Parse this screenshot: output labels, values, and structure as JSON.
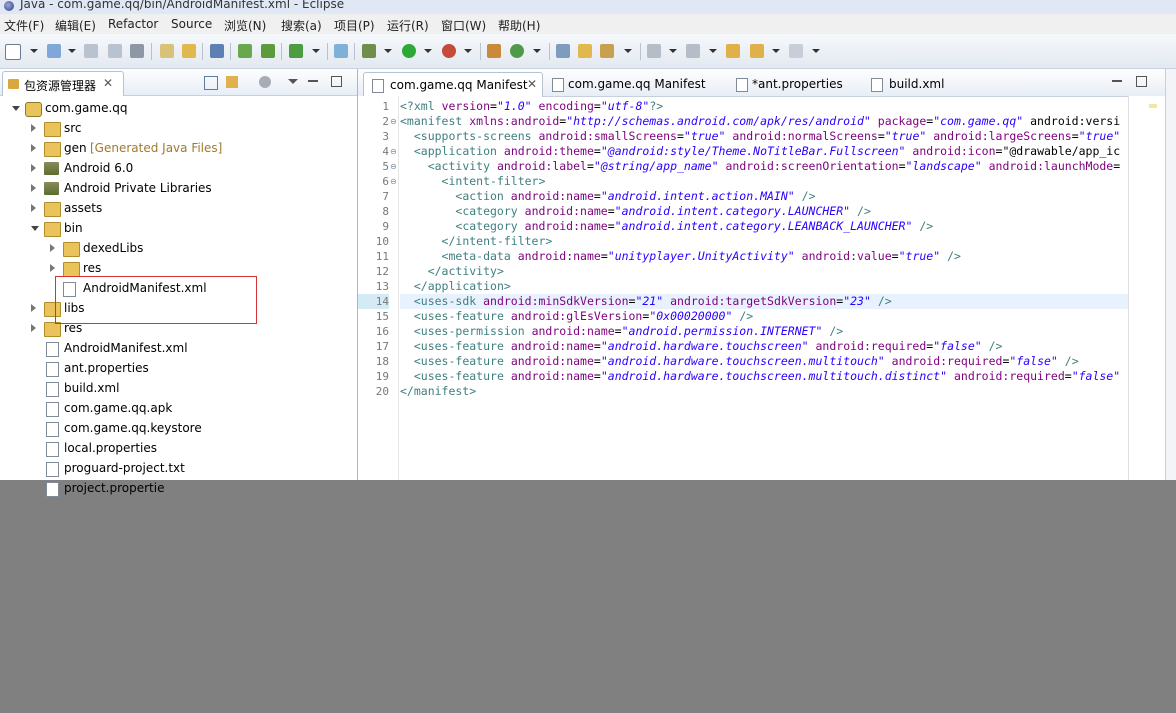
{
  "window": {
    "title": "Java - com.game.qq/bin/AndroidManifest.xml - Eclipse"
  },
  "menu": [
    "文件(F)",
    "编辑(E)",
    "Refactor",
    "Source",
    "浏览(N)",
    "搜索(a)",
    "项目(P)",
    "运行(R)",
    "窗口(W)",
    "帮助(H)"
  ],
  "explorer": {
    "title": "包资源管理器",
    "close": "✕",
    "tree": [
      {
        "label": "com.game.qq",
        "icon": "project-icon",
        "twisty": "expanded"
      },
      {
        "label": "src",
        "icon": "package-folder-icon",
        "twisty": "collapsed"
      },
      {
        "label": "gen",
        "decoration": "[Generated Java Files]",
        "icon": "package-folder-icon",
        "twisty": "collapsed"
      },
      {
        "label": "Android 6.0",
        "icon": "library-icon",
        "twisty": "collapsed"
      },
      {
        "label": "Android Private Libraries",
        "icon": "library-icon",
        "twisty": "collapsed"
      },
      {
        "label": "assets",
        "icon": "folder-icon",
        "twisty": "collapsed"
      },
      {
        "label": "bin",
        "icon": "folder-icon",
        "twisty": "expanded"
      },
      {
        "label": "dexedLibs",
        "icon": "folder-icon",
        "twisty": "collapsed"
      },
      {
        "label": "res",
        "icon": "folder-icon",
        "twisty": "collapsed"
      },
      {
        "label": "AndroidManifest.xml",
        "icon": "xml-file-icon",
        "twisty": "none"
      },
      {
        "label": "libs",
        "icon": "folder-icon",
        "twisty": "collapsed"
      },
      {
        "label": "res",
        "icon": "folder-icon",
        "twisty": "collapsed"
      },
      {
        "label": "AndroidManifest.xml",
        "icon": "xml-file-icon",
        "twisty": "none"
      },
      {
        "label": "ant.properties",
        "icon": "file-icon",
        "twisty": "none"
      },
      {
        "label": "build.xml",
        "icon": "xml-file-icon",
        "twisty": "none"
      },
      {
        "label": "com.game.qq.apk",
        "icon": "file-icon",
        "twisty": "none"
      },
      {
        "label": "com.game.qq.keystore",
        "icon": "file-icon",
        "twisty": "none"
      },
      {
        "label": "local.properties",
        "icon": "file-icon",
        "twisty": "none"
      },
      {
        "label": "proguard-project.txt",
        "icon": "file-icon",
        "twisty": "none"
      },
      {
        "label": "project.propertie",
        "icon": "file-icon",
        "twisty": "none"
      }
    ]
  },
  "editor": {
    "tabs": [
      {
        "label": "com.game.qq Manifest",
        "close": "✕",
        "active": true
      },
      {
        "label": "com.game.qq Manifest",
        "active": false
      },
      {
        "label": "*ant.properties",
        "active": false
      },
      {
        "label": "build.xml",
        "active": false
      }
    ],
    "line_numbers": [
      "1",
      "2",
      "3",
      "4",
      "5",
      "6",
      "7",
      "8",
      "9",
      "10",
      "11",
      "12",
      "13",
      "14",
      "15",
      "16",
      "17",
      "18",
      "19",
      "20"
    ],
    "code": [
      "<?xml version=\"1.0\" encoding=\"utf-8\"?>",
      "<manifest xmlns:android=\"http://schemas.android.com/apk/res/android\" package=\"com.game.qq\" android:versi",
      "  <supports-screens android:smallScreens=\"true\" android:normalScreens=\"true\" android:largeScreens=\"true\"",
      "  <application android:theme=\"@android:style/Theme.NoTitleBar.Fullscreen\" android:icon=\"@drawable/app_ic",
      "    <activity android:label=\"@string/app_name\" android:screenOrientation=\"landscape\" android:launchMode=",
      "      <intent-filter>",
      "        <action android:name=\"android.intent.action.MAIN\" />",
      "        <category android:name=\"android.intent.category.LAUNCHER\" />",
      "        <category android:name=\"android.intent.category.LEANBACK_LAUNCHER\" />",
      "      </intent-filter>",
      "      <meta-data android:name=\"unityplayer.UnityActivity\" android:value=\"true\" />",
      "    </activity>",
      "  </application>",
      "  <uses-sdk android:minSdkVersion=\"21\" android:targetSdkVersion=\"23\" />",
      "  <uses-feature android:glEsVersion=\"0x00020000\" />",
      "  <uses-permission android:name=\"android.permission.INTERNET\" />",
      "  <uses-feature android:name=\"android.hardware.touchscreen\" android:required=\"false\" />",
      "  <uses-feature android:name=\"android.hardware.touchscreen.multitouch\" android:required=\"false\" />",
      "  <uses-feature android:name=\"android.hardware.touchscreen.multitouch.distinct\" android:required=\"false\"",
      "</manifest>"
    ]
  }
}
